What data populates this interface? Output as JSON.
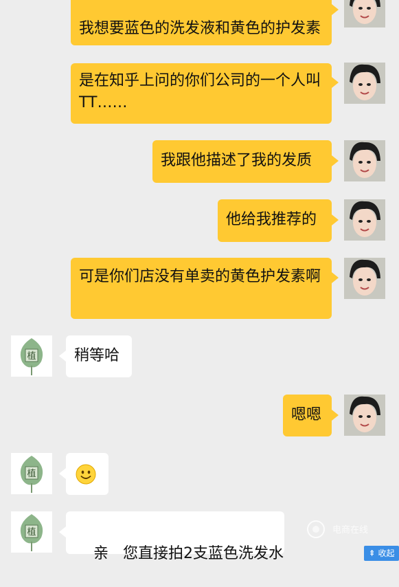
{
  "messages": [
    {
      "side": "me",
      "text": "我想要蓝色的洗发液和黄色的护发素"
    },
    {
      "side": "me",
      "text": "是在知乎上问的你们公司的一个人叫TT……"
    },
    {
      "side": "me",
      "text": "我跟他描述了我的发质"
    },
    {
      "side": "me",
      "text": "他给我推荐的"
    },
    {
      "side": "me",
      "text": "可是你们店没有单卖的黄色护发素啊"
    },
    {
      "side": "other",
      "text": "稍等哈"
    },
    {
      "side": "me",
      "text": "嗯嗯"
    },
    {
      "side": "other",
      "emoji": "smile-emoji"
    },
    {
      "side": "other",
      "text": "亲   您直接拍2支蓝色洗发水"
    }
  ],
  "avatar_other_char": "植",
  "watermark": {
    "text": "电商在线"
  },
  "collapse": {
    "label": "收起"
  },
  "colors": {
    "bubble_me": "#ffc932",
    "bubble_other": "#ffffff",
    "background": "#ededed",
    "collapse": "#3a8ee6"
  }
}
